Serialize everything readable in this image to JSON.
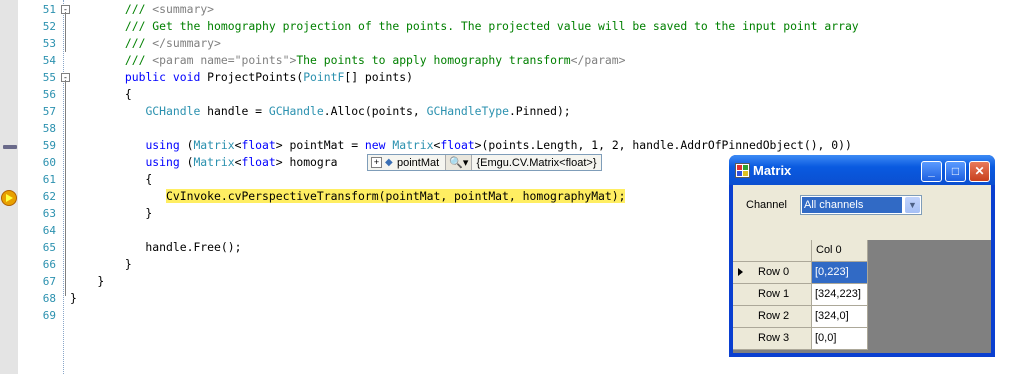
{
  "editor": {
    "lines": [
      {
        "num": "51",
        "segments": [
          {
            "t": "        ",
            "c": ""
          },
          {
            "t": "///",
            "c": "cm"
          },
          {
            "t": " <summary>",
            "c": "xml"
          }
        ]
      },
      {
        "num": "52",
        "segments": [
          {
            "t": "        ",
            "c": ""
          },
          {
            "t": "/// Get the homography projection of the points. The projected value will be saved to the input point array",
            "c": "cm"
          }
        ]
      },
      {
        "num": "53",
        "segments": [
          {
            "t": "        ",
            "c": ""
          },
          {
            "t": "///",
            "c": "cm"
          },
          {
            "t": " </summary>",
            "c": "xml"
          }
        ]
      },
      {
        "num": "54",
        "segments": [
          {
            "t": "        ",
            "c": ""
          },
          {
            "t": "///",
            "c": "cm"
          },
          {
            "t": " <param name=\"points\">",
            "c": "xml"
          },
          {
            "t": "The points to apply homography transform",
            "c": "cm"
          },
          {
            "t": "</param>",
            "c": "xml"
          }
        ]
      },
      {
        "num": "55",
        "segments": [
          {
            "t": "        ",
            "c": ""
          },
          {
            "t": "public",
            "c": "kw"
          },
          {
            "t": " ",
            "c": ""
          },
          {
            "t": "void",
            "c": "kw"
          },
          {
            "t": " ProjectPoints(",
            "c": ""
          },
          {
            "t": "PointF",
            "c": "ty"
          },
          {
            "t": "[] points)",
            "c": ""
          }
        ]
      },
      {
        "num": "56",
        "segments": [
          {
            "t": "        {",
            "c": ""
          }
        ]
      },
      {
        "num": "57",
        "segments": [
          {
            "t": "           ",
            "c": ""
          },
          {
            "t": "GCHandle",
            "c": "ty"
          },
          {
            "t": " handle = ",
            "c": ""
          },
          {
            "t": "GCHandle",
            "c": "ty"
          },
          {
            "t": ".Alloc(points, ",
            "c": ""
          },
          {
            "t": "GCHandleType",
            "c": "ty"
          },
          {
            "t": ".Pinned);",
            "c": ""
          }
        ]
      },
      {
        "num": "58",
        "segments": [
          {
            "t": "",
            "c": ""
          }
        ]
      },
      {
        "num": "59",
        "segments": [
          {
            "t": "           ",
            "c": ""
          },
          {
            "t": "using",
            "c": "kw"
          },
          {
            "t": " (",
            "c": ""
          },
          {
            "t": "Matrix",
            "c": "ty"
          },
          {
            "t": "<",
            "c": ""
          },
          {
            "t": "float",
            "c": "kw"
          },
          {
            "t": "> pointMat = ",
            "c": ""
          },
          {
            "t": "new",
            "c": "kw"
          },
          {
            "t": " ",
            "c": ""
          },
          {
            "t": "Matrix",
            "c": "ty"
          },
          {
            "t": "<",
            "c": ""
          },
          {
            "t": "float",
            "c": "kw"
          },
          {
            "t": ">(points.Length, 1, 2, handle.AddrOfPinnedObject(), 0))",
            "c": ""
          }
        ]
      },
      {
        "num": "60",
        "segments": [
          {
            "t": "           ",
            "c": ""
          },
          {
            "t": "using",
            "c": "kw"
          },
          {
            "t": " (",
            "c": ""
          },
          {
            "t": "Matrix",
            "c": "ty"
          },
          {
            "t": "<",
            "c": ""
          },
          {
            "t": "float",
            "c": "kw"
          },
          {
            "t": "> homogra",
            "c": ""
          }
        ]
      },
      {
        "num": "61",
        "segments": [
          {
            "t": "           {",
            "c": ""
          }
        ]
      },
      {
        "num": "62",
        "segments": [
          {
            "t": "              ",
            "c": ""
          },
          {
            "t": "CvInvoke.cvPerspectiveTransform(pointMat, pointMat, homographyMat);",
            "c": "hl"
          }
        ]
      },
      {
        "num": "63",
        "segments": [
          {
            "t": "           }",
            "c": ""
          }
        ]
      },
      {
        "num": "64",
        "segments": [
          {
            "t": "",
            "c": ""
          }
        ]
      },
      {
        "num": "65",
        "segments": [
          {
            "t": "           handle.Free();",
            "c": ""
          }
        ]
      },
      {
        "num": "66",
        "segments": [
          {
            "t": "        }",
            "c": ""
          }
        ]
      },
      {
        "num": "67",
        "segments": [
          {
            "t": "    }",
            "c": ""
          }
        ]
      },
      {
        "num": "68",
        "segments": [
          {
            "t": "}",
            "c": ""
          }
        ]
      },
      {
        "num": "69",
        "segments": [
          {
            "t": "",
            "c": ""
          }
        ]
      }
    ]
  },
  "datatip": {
    "name": "pointMat",
    "value": "{Emgu.CV.Matrix<float>}"
  },
  "matrix_window": {
    "title": "Matrix",
    "channel_label": "Channel",
    "channel_value": "All channels",
    "column_header": "Col 0",
    "rows": [
      {
        "label": "Row 0",
        "value": "[0,223]"
      },
      {
        "label": "Row 1",
        "value": "[324,223]"
      },
      {
        "label": "Row 2",
        "value": "[324,0]"
      },
      {
        "label": "Row 3",
        "value": "[0,0]"
      }
    ]
  }
}
